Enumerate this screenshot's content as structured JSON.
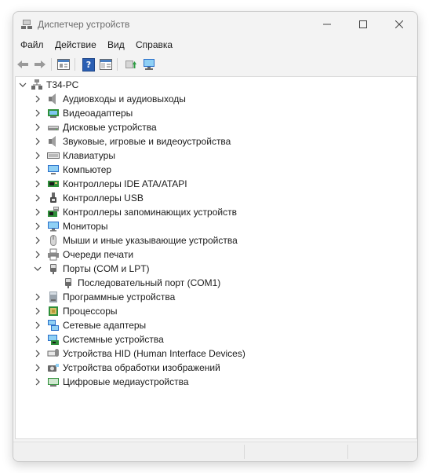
{
  "window": {
    "title": "Диспетчер устройств"
  },
  "menu": [
    "Файл",
    "Действие",
    "Вид",
    "Справка"
  ],
  "toolbar": {
    "help_label": "?"
  },
  "tree": {
    "root": "T34-PC",
    "items": [
      {
        "label": "Аудиовходы и аудиовыходы",
        "icon": "audio-io-icon"
      },
      {
        "label": "Видеоадаптеры",
        "icon": "display-adapter-icon"
      },
      {
        "label": "Дисковые устройства",
        "icon": "disk-drive-icon"
      },
      {
        "label": "Звуковые, игровые и видеоустройства",
        "icon": "sound-icon"
      },
      {
        "label": "Клавиатуры",
        "icon": "keyboard-icon"
      },
      {
        "label": "Компьютер",
        "icon": "computer-icon"
      },
      {
        "label": "Контроллеры IDE ATA/ATAPI",
        "icon": "ide-controller-icon"
      },
      {
        "label": "Контроллеры USB",
        "icon": "usb-icon"
      },
      {
        "label": "Контроллеры запоминающих устройств",
        "icon": "storage-controller-icon"
      },
      {
        "label": "Мониторы",
        "icon": "monitor-icon"
      },
      {
        "label": "Мыши и иные указывающие устройства",
        "icon": "mouse-icon"
      },
      {
        "label": "Очереди печати",
        "icon": "printer-icon"
      },
      {
        "label": "Порты (COM и LPT)",
        "icon": "port-icon",
        "expanded": true,
        "children": [
          {
            "label": "Последовательный порт (COM1)",
            "icon": "port-icon"
          }
        ]
      },
      {
        "label": "Программные устройства",
        "icon": "software-device-icon"
      },
      {
        "label": "Процессоры",
        "icon": "processor-icon"
      },
      {
        "label": "Сетевые адаптеры",
        "icon": "network-adapter-icon"
      },
      {
        "label": "Системные устройства",
        "icon": "system-device-icon"
      },
      {
        "label": "Устройства HID (Human Interface Devices)",
        "icon": "hid-icon"
      },
      {
        "label": "Устройства обработки изображений",
        "icon": "imaging-device-icon"
      },
      {
        "label": "Цифровые медиаустройства",
        "icon": "digital-media-icon"
      }
    ]
  },
  "colors": {
    "window_bg": "#f3f3f3",
    "tree_bg": "#ffffff",
    "accent": "#2a6fc9"
  }
}
